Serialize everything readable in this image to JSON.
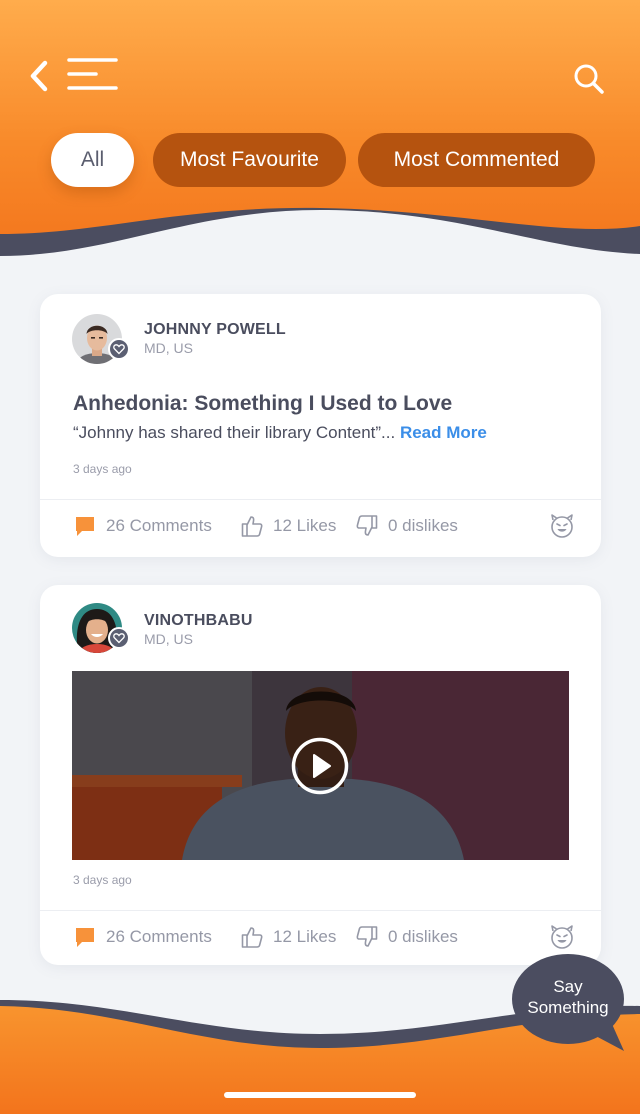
{
  "header": {
    "back_icon": "chevron-left-icon",
    "menu_icon": "menu-icon",
    "search_icon": "search-icon",
    "tabs": [
      {
        "label": "All",
        "active": true
      },
      {
        "label": "Most Favourite",
        "active": false
      },
      {
        "label": "Most Commented",
        "active": false
      }
    ]
  },
  "posts": [
    {
      "author": "JOHNNY POWELL",
      "location": "MD, US",
      "title": "Anhedonia: Something I Used to Love",
      "excerpt": "“Johnny has shared their library Content”...",
      "read_more": "Read More",
      "time": "3 days ago",
      "comments": "26 Comments",
      "likes": "12 Likes",
      "dislikes": "0 dislikes"
    },
    {
      "author": "VINOTHBABU",
      "location": "MD, US",
      "media": "video",
      "time": "3 days ago",
      "comments": "26 Comments",
      "likes": "12 Likes",
      "dislikes": "0 dislikes"
    }
  ],
  "say_something": {
    "line1": "Say",
    "line2": "Something"
  },
  "colors": {
    "header_top": "#ffac4c",
    "header_bottom": "#f3741c",
    "tab_inactive": "#b5530f",
    "wave_dark": "#4b4d60",
    "link": "#3b8ee8",
    "comment_icon": "#f7923a",
    "background": "#f2f4f7"
  }
}
